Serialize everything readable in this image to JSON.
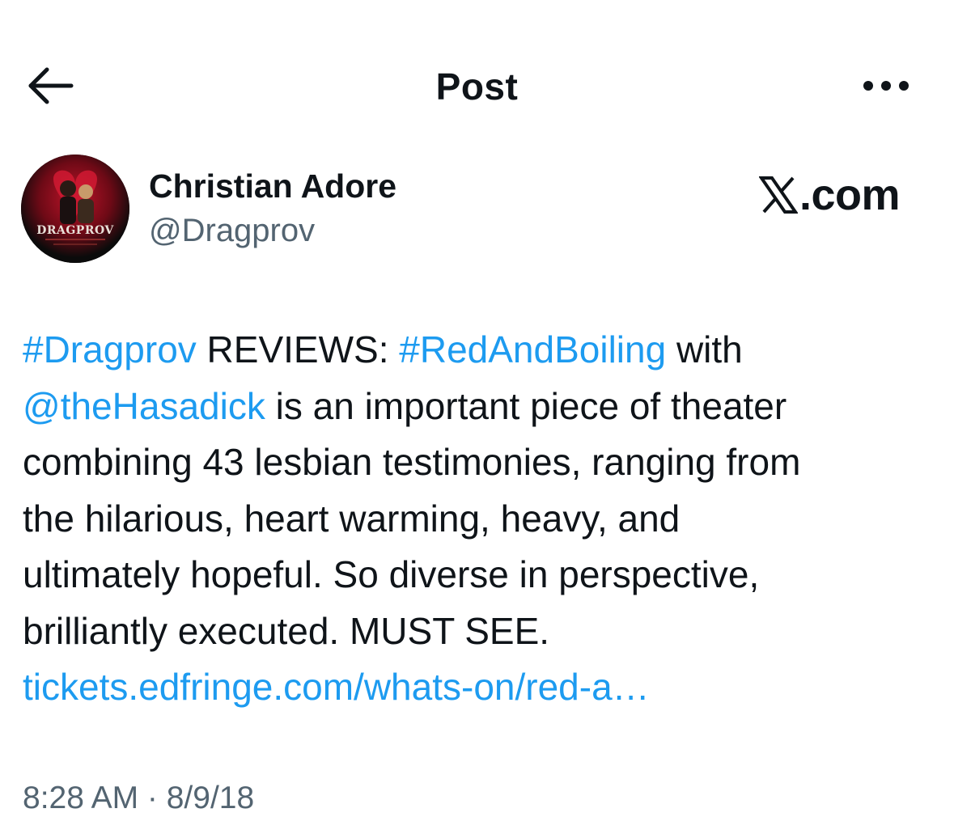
{
  "header": {
    "title": "Post",
    "back_icon": "arrow-left-icon",
    "more_icon": "more-horizontal-icon"
  },
  "author": {
    "display_name": "Christian Adore",
    "handle": "@Dragprov",
    "avatar_text": "DRAGPROV"
  },
  "watermark": {
    "logo_icon": "x-logo-icon",
    "text": ".com"
  },
  "tweet": {
    "line1": {
      "hashtag1": "#Dragprov",
      "text1": " REVIEWS: ",
      "hashtag2": "#RedAndBoiling",
      "text2": " with"
    },
    "line2": {
      "mention": "@theHasadick",
      "text": " is an important piece of theater"
    },
    "line3": "combining 43 lesbian testimonies, ranging from",
    "line4": "the hilarious, heart warming, heavy, and",
    "line5": "ultimately hopeful. So diverse in perspective,",
    "line6": "brilliantly executed. MUST SEE.",
    "link": "tickets.edfringe.com/whats-on/red-a…"
  },
  "meta": {
    "timestamp": "8:28 AM · 8/9/18"
  },
  "colors": {
    "link": "#1d9bf0",
    "secondary": "#536471",
    "text": "#0f1419"
  }
}
